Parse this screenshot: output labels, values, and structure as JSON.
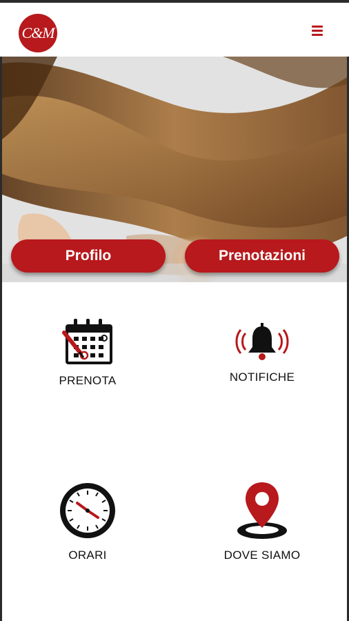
{
  "header": {
    "logo_text": "C&M",
    "menu_icon": "hamburger-menu-icon",
    "accent": "#b7191c"
  },
  "hero": {
    "image": "woman-flowing-hair-photo",
    "buttons": {
      "profile": "Profilo",
      "bookings": "Prenotazioni"
    }
  },
  "tiles": [
    {
      "label": "PRENOTA",
      "icon": "calendar-icon"
    },
    {
      "label": "NOTIFICHE",
      "icon": "bell-icon"
    },
    {
      "label": "ORARI",
      "icon": "clock-icon"
    },
    {
      "label": "DOVE SIAMO",
      "icon": "map-pin-icon"
    }
  ]
}
